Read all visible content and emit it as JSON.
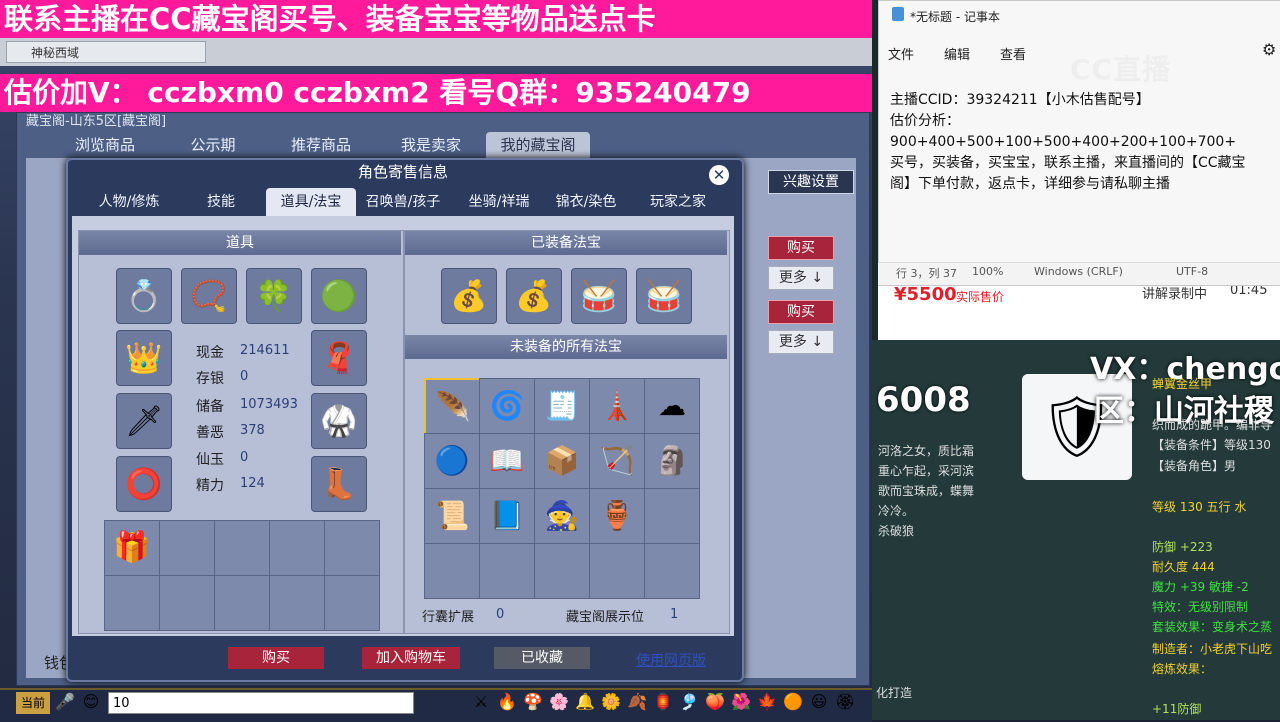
{
  "banner_top": "联系主播在CC藏宝阁买号、装备宝宝等物品送点卡",
  "banner_price": "估价加V： cczbxm0  cczbxm2  看号Q群：935240479",
  "browser_tab": "神秘西域",
  "outer_window": {
    "title": "藏宝阁-山东5区[藏宝阁]",
    "tabs": [
      "浏览商品",
      "公示期",
      "推荐商品",
      "我是卖家",
      "我的藏宝阁"
    ],
    "interest_button": "兴趣设置",
    "buy_label": "购买",
    "more_label": "更多",
    "money_label": "钱包"
  },
  "dialog": {
    "title": "角色寄售信息",
    "tabs": [
      "人物/修炼",
      "技能",
      "道具/法宝",
      "召唤兽/孩子",
      "坐骑/祥瑞",
      "锦衣/染色",
      "玩家之家"
    ],
    "active_tab": "道具/法宝",
    "items_header": "道具",
    "equipped_fabao_header": "已装备法宝",
    "unequipped_fabao_header": "未装备的所有法宝",
    "stats": [
      {
        "label": "现金",
        "value": "214611"
      },
      {
        "label": "存银",
        "value": "0"
      },
      {
        "label": "储备",
        "value": "1073493"
      },
      {
        "label": "善恶",
        "value": "378"
      },
      {
        "label": "仙玉",
        "value": "0"
      },
      {
        "label": "精力",
        "value": "124"
      }
    ],
    "bag_expand_label": "行囊扩展",
    "bag_expand_value": "0",
    "showcase_label": "藏宝阁展示位",
    "showcase_value": "1",
    "buttons": {
      "buy": "购买",
      "add_cart": "加入购物车",
      "favorited": "已收藏",
      "web": "使用网页版"
    }
  },
  "taskbar": {
    "channel": "当前",
    "chat_value": "10"
  },
  "notepad": {
    "title": "*无标题 - 记事本",
    "menu": [
      "文件",
      "编辑",
      "查看"
    ],
    "text": "主播CCID：39324211【小木估售配号】\n估价分析：\n900+400+500+100+500+400+200+100+700+\n买号，买装备，买宝宝，联系主播，来直播间的【CC藏宝\n阁】下单付款，返点卡，详细参与请私聊主播",
    "status": {
      "position": "行 3，列 37",
      "zoom": "100%",
      "eol": "Windows (CRLF)",
      "encoding": "UTF-8"
    }
  },
  "cc_logo": "CC直播",
  "product": {
    "price": "¥5500",
    "price_label": "实际售价",
    "recording": "讲解录制中",
    "time": "01:45"
  },
  "overlay": {
    "num": "6008",
    "vx": "VX：chengch",
    "qu": "区：山河社稷"
  },
  "item_tooltip": {
    "name": "蝉翼金丝甲",
    "desc1": "河洛之女，质比霜",
    "desc2": "重心乍起，采河滨",
    "desc3": "歌而宝珠成，蝶舞",
    "desc4": "冷冷。",
    "desc5": "杀破狼",
    "line_a": "织而成的跪甲。编非导",
    "cond": "【装备条件】等级130",
    "role": "【装备角色】男",
    "level": "等级 130 五行 水",
    "def": "防御 +223",
    "dur": "耐久度 444",
    "magic": "魔力 +39 敏捷 -2",
    "special": "特效：无级别限制",
    "set": "套装效果：变身术之蒸",
    "maker": "制造者：小老虎下山吃",
    "forge": "熔炼效果：",
    "forge_val": "+11防御",
    "qh": "化打造"
  }
}
